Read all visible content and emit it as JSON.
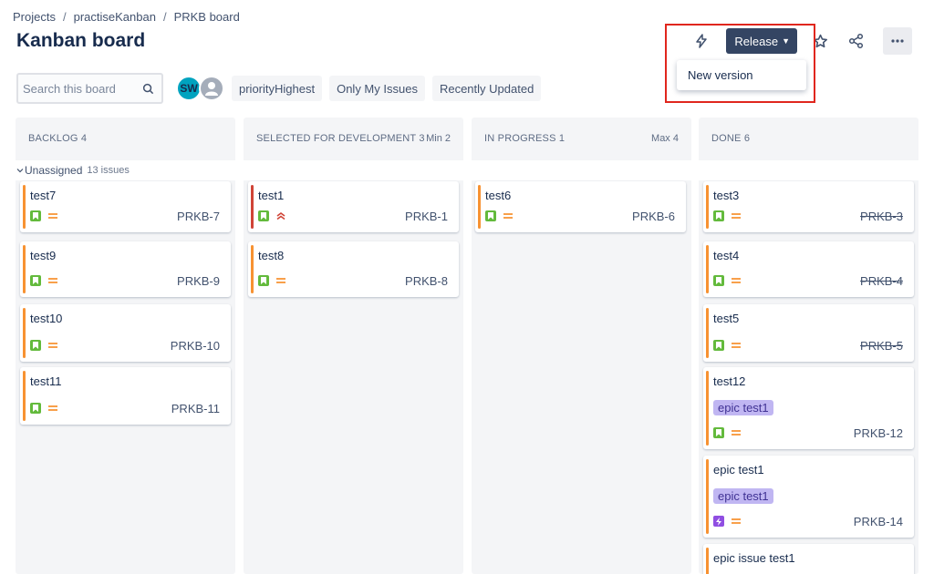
{
  "breadcrumb": [
    "Projects",
    "practiseKanban",
    "PRKB board"
  ],
  "page_title": "Kanban board",
  "release_label": "Release",
  "dropdown_item": "New version",
  "search_placeholder": "Search this board",
  "avatar_initials": "SW",
  "filters": [
    "priorityHighest",
    "Only My Issues",
    "Recently Updated"
  ],
  "columns": [
    {
      "name": "BACKLOG",
      "count": "4",
      "limit": ""
    },
    {
      "name": "SELECTED FOR DEVELOPMENT",
      "count": "3",
      "limit": "Min 2"
    },
    {
      "name": "IN PROGRESS",
      "count": "1",
      "limit": "Max 4"
    },
    {
      "name": "DONE",
      "count": "6",
      "limit": ""
    }
  ],
  "swimlane": {
    "label": "Unassigned",
    "count": "13 issues"
  },
  "cards": [
    {
      "title": "test7",
      "key": "PRKB-7",
      "type": "story",
      "priority": "medium"
    },
    {
      "title": "test9",
      "key": "PRKB-9",
      "type": "story",
      "priority": "medium"
    },
    {
      "title": "test10",
      "key": "PRKB-10",
      "type": "story",
      "priority": "medium"
    },
    {
      "title": "test11",
      "key": "PRKB-11",
      "type": "story",
      "priority": "medium"
    },
    {
      "title": "test1",
      "key": "PRKB-1",
      "type": "story",
      "priority": "highest"
    },
    {
      "title": "test8",
      "key": "PRKB-8",
      "type": "story",
      "priority": "medium"
    },
    {
      "title": "test6",
      "key": "PRKB-6",
      "type": "story",
      "priority": "medium"
    },
    {
      "title": "test3",
      "key": "PRKB-3",
      "type": "story",
      "priority": "medium",
      "done": true
    },
    {
      "title": "test4",
      "key": "PRKB-4",
      "type": "story",
      "priority": "medium",
      "done": true
    },
    {
      "title": "test5",
      "key": "PRKB-5",
      "type": "story",
      "priority": "medium",
      "done": true
    },
    {
      "title": "test12",
      "key": "PRKB-12",
      "type": "story",
      "priority": "medium",
      "epic": "epic test1"
    },
    {
      "title": "epic test1",
      "key": "PRKB-14",
      "type": "epic",
      "priority": "medium",
      "epic": "epic test1"
    },
    {
      "title": "epic issue test1",
      "key": "",
      "type": "story",
      "priority": "medium"
    }
  ],
  "colors": {
    "accent": "#344563",
    "story": "#63BA3C",
    "epic": "#904EE2",
    "medium": "#F79232",
    "highest": "#D04437"
  }
}
